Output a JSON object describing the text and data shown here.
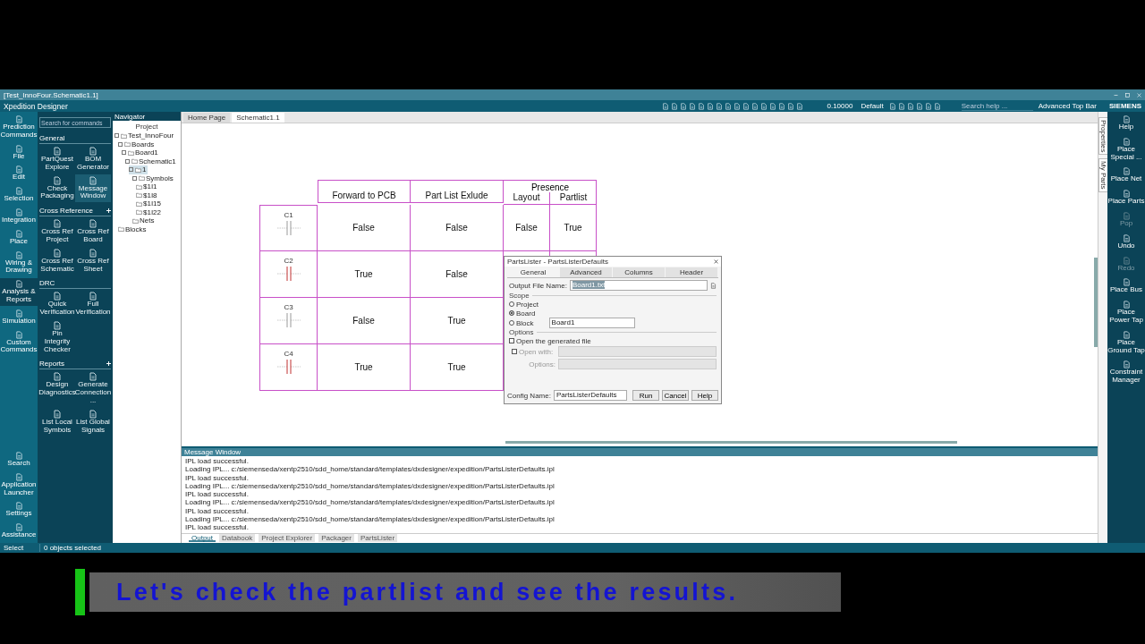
{
  "window": {
    "title": "[Test_InnoFour.Schematic1.1]",
    "app_name": "Xpedition Designer"
  },
  "toolbar": {
    "zoom": "0.10000",
    "scheme": "Default",
    "search": {
      "placeholder": "Search help ..."
    },
    "layout": "Advanced Top Bar",
    "brand": "SIEMENS"
  },
  "left_rail": {
    "items": [
      {
        "label": "Prediction Commands",
        "selected": false
      },
      {
        "label": "File",
        "selected": false
      },
      {
        "label": "Edit",
        "selected": false
      },
      {
        "label": "Selection",
        "selected": false
      },
      {
        "label": "Integration",
        "selected": false
      },
      {
        "label": "Place",
        "selected": false
      },
      {
        "label": "Wiring & Drawing",
        "selected": false
      },
      {
        "label": "Analysis & Reports",
        "selected": true
      },
      {
        "label": "Simulation",
        "selected": false
      },
      {
        "label": "Custom Commands",
        "selected": false
      }
    ],
    "bottom_items": [
      "Search",
      "Application Launcher",
      "Settings",
      "Assistance"
    ]
  },
  "commands": {
    "search": {
      "placeholder": "Search for commands"
    },
    "sections": [
      {
        "title": "General",
        "pinned": false,
        "items": [
          {
            "label": "PartQuest Explore",
            "selected": false
          },
          {
            "label": "BOM Generator",
            "selected": false
          },
          {
            "label": "Check Packaging",
            "selected": false
          },
          {
            "label": "Message Window",
            "selected": true
          }
        ]
      },
      {
        "title": "Cross Reference",
        "pinned": true,
        "items": [
          {
            "label": "Cross Ref Project",
            "selected": false
          },
          {
            "label": "Cross Ref Board",
            "selected": false
          },
          {
            "label": "Cross Ref Schematic",
            "selected": false
          },
          {
            "label": "Cross Ref Sheet",
            "selected": false
          }
        ]
      },
      {
        "title": "DRC",
        "pinned": false,
        "items": [
          {
            "label": "Quick Verification",
            "selected": false
          },
          {
            "label": "Full Verification",
            "selected": false
          },
          {
            "label": "Pin Integrity Checker",
            "selected": false
          }
        ]
      },
      {
        "title": "Reports",
        "pinned": true,
        "items": [
          {
            "label": "Design Diagnostics",
            "selected": false
          },
          {
            "label": "Generate Connection ...",
            "selected": false
          },
          {
            "label": "List Local Symbols",
            "selected": false
          },
          {
            "label": "List Global Signals",
            "selected": false
          }
        ]
      }
    ]
  },
  "navigator": {
    "title": "Navigator",
    "heading": "Project",
    "tree": [
      {
        "label": "Test_InnoFour",
        "selected": false,
        "children": [
          {
            "label": "Boards",
            "selected": false,
            "children": [
              {
                "label": "Board1",
                "selected": false,
                "children": [
                  {
                    "label": "Schematic1",
                    "selected": false,
                    "children": [
                      {
                        "label": "1",
                        "selected": true,
                        "children": [
                          {
                            "label": "Symbols",
                            "selected": false,
                            "children": [
                              {
                                "label": "$1I1",
                                "selected": false
                              },
                              {
                                "label": "$1I8",
                                "selected": false
                              },
                              {
                                "label": "$1I15",
                                "selected": false
                              },
                              {
                                "label": "$1I22",
                                "selected": false
                              }
                            ]
                          },
                          {
                            "label": "Nets",
                            "selected": false
                          }
                        ]
                      }
                    ]
                  }
                ]
              }
            ]
          },
          {
            "label": "Blocks",
            "selected": false
          }
        ]
      }
    ]
  },
  "tabs": [
    {
      "label": "Home Page",
      "selected": false
    },
    {
      "label": "Schematic1.1",
      "selected": true
    }
  ],
  "table": {
    "columns": [
      "Forward to PCB",
      "Part List Exlude"
    ],
    "group": {
      "label": "Presence",
      "columns": [
        "Layout",
        "Partlist"
      ]
    },
    "rows": [
      {
        "ref": "C1",
        "cells": [
          "False",
          "False",
          "False",
          "True"
        ]
      },
      {
        "ref": "C2",
        "cells": [
          "True",
          "False"
        ]
      },
      {
        "ref": "C3",
        "cells": [
          "False",
          "True"
        ]
      },
      {
        "ref": "C4",
        "cells": [
          "True",
          "True"
        ]
      }
    ]
  },
  "dialog": {
    "title": "PartsLister - PartsListerDefaults",
    "tabs": [
      {
        "label": "General",
        "selected": true
      },
      {
        "label": "Advanced",
        "selected": false
      },
      {
        "label": "Columns",
        "selected": false
      },
      {
        "label": "Header",
        "selected": false
      }
    ],
    "output_label": "Output File Name:",
    "output_value": "Board1.txt",
    "scope_label": "Scope",
    "scope": [
      {
        "label": "Project",
        "selected": false
      },
      {
        "label": "Board",
        "selected": true
      },
      {
        "label": "Block",
        "selected": false
      }
    ],
    "block_value": "Board1",
    "options_label": "Options",
    "open_generated": {
      "label": "Open the generated file",
      "checked": false
    },
    "open_with": {
      "label": "Open with:",
      "checked": false,
      "disabled": true
    },
    "options_field_label": "Options:",
    "config_label": "Config Name:",
    "config_value": "PartsListerDefaults",
    "buttons": [
      "Run",
      "Cancel",
      "Help"
    ]
  },
  "message_window": {
    "title": "Message Window",
    "lines": [
      "IPL load successful.",
      "Loading IPL... c:/siemenseda/xentp2510/sdd_home/standard/templates/dxdesigner/expedition/PartsListerDefaults.ipl",
      "IPL load successful.",
      "Loading IPL... c:/siemenseda/xentp2510/sdd_home/standard/templates/dxdesigner/expedition/PartsListerDefaults.ipl",
      "IPL load successful.",
      "Loading IPL... c:/siemenseda/xentp2510/sdd_home/standard/templates/dxdesigner/expedition/PartsListerDefaults.ipl",
      "IPL load successful.",
      "Loading IPL... c:/siemenseda/xentp2510/sdd_home/standard/templates/dxdesigner/expedition/PartsListerDefaults.ipl",
      "IPL load successful."
    ],
    "tabs": [
      {
        "label": "Output",
        "selected": true
      },
      {
        "label": "Databook",
        "selected": false
      },
      {
        "label": "Project Explorer",
        "selected": false
      },
      {
        "label": "Packager",
        "selected": false
      },
      {
        "label": "PartsLister",
        "selected": false
      }
    ]
  },
  "right_rail": {
    "side_tabs": [
      "Properties",
      "My Parts"
    ],
    "items": [
      {
        "label": "Help",
        "disabled": false
      },
      {
        "label": "Place Special ...",
        "disabled": false
      },
      {
        "label": "Place Net",
        "disabled": false
      },
      {
        "label": "Place Parts",
        "disabled": false
      },
      {
        "label": "Pop",
        "disabled": true
      },
      {
        "label": "Undo",
        "disabled": false
      },
      {
        "label": "Redo",
        "disabled": true
      },
      {
        "label": "Place Bus",
        "disabled": false
      },
      {
        "label": "Place Power Tap",
        "disabled": false
      },
      {
        "label": "Place Ground Tap",
        "disabled": false
      },
      {
        "label": "Constraint Manager",
        "disabled": false
      }
    ]
  },
  "status_bar": {
    "mode": "Select",
    "selection": "0 objects selected"
  },
  "caption": "Let's check the partlist and see the results."
}
